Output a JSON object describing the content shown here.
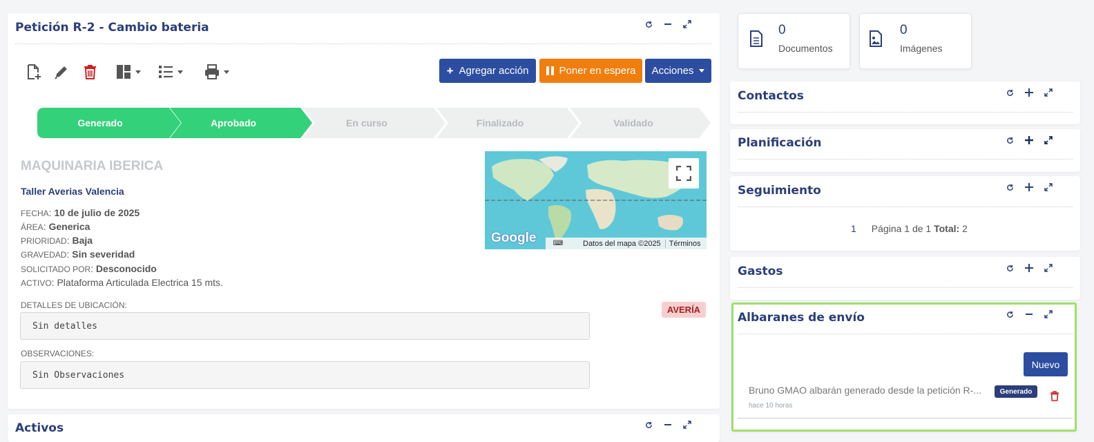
{
  "main_panel": {
    "title": "Petición R-2 - Cambio bateria",
    "buttons": {
      "add_action": "Agregar acción",
      "hold": "Poner en espera",
      "actions": "Acciones"
    },
    "steps": [
      {
        "label": "Generado",
        "state": "done"
      },
      {
        "label": "Aprobado",
        "state": "done"
      },
      {
        "label": "En curso",
        "state": "pending"
      },
      {
        "label": "Finalizado",
        "state": "pending"
      },
      {
        "label": "Validado",
        "state": "pending"
      }
    ],
    "company": "MAQUINARIA IBERICA",
    "workshop": "Taller Averias Valencia",
    "details": {
      "fecha_label": "Fecha",
      "fecha_value": "10 de julio de 2025",
      "area_label": "Área",
      "area_value": "Generica",
      "prioridad_label": "Prioridad",
      "prioridad_value": "Baja",
      "gravedad_label": "Gravedad",
      "gravedad_value": "Sin severidad",
      "solicitado_label": "Solicitado por",
      "solicitado_value": "Desconocido",
      "activo_label": "Activo",
      "activo_value": "Plataforma Articulada Electrica 15 mts."
    },
    "ubicacion_label": "DETALLES DE UBICACIÓN:",
    "ubicacion_value": "Sin detalles",
    "observaciones_label": "OBSERVACIONES:",
    "observaciones_value": "Sin Observaciones",
    "type_badge": "AVERÍA",
    "map": {
      "attribution": "Datos del mapa ©2025",
      "terms": "Términos",
      "logo": "Google"
    }
  },
  "activos_panel": {
    "title": "Activos"
  },
  "stats": {
    "documents": {
      "count": "0",
      "label": "Documentos"
    },
    "images": {
      "count": "0",
      "label": "Imágenes"
    }
  },
  "side_panels": {
    "contactos": "Contactos",
    "planificacion": "Planificación",
    "seguimiento": "Seguimiento",
    "gastos": "Gastos",
    "albaranes": "Albaranes de envío"
  },
  "seguimiento_pager": {
    "page_num": "1",
    "page_text": "Página 1 de 1",
    "total_label": "Total:",
    "total_value": "2"
  },
  "albaranes": {
    "new_button": "Nuevo",
    "item_text": "Bruno GMAO albarán generado desde la petición R-...",
    "item_status": "Generado",
    "item_time": "hace 10 horas"
  },
  "colors": {
    "primary": "#2c4da0",
    "orange": "#f07e0e",
    "green": "#33d17a",
    "title": "#2c3e7a",
    "danger": "#cc2222",
    "highlight": "#9ee06b"
  }
}
